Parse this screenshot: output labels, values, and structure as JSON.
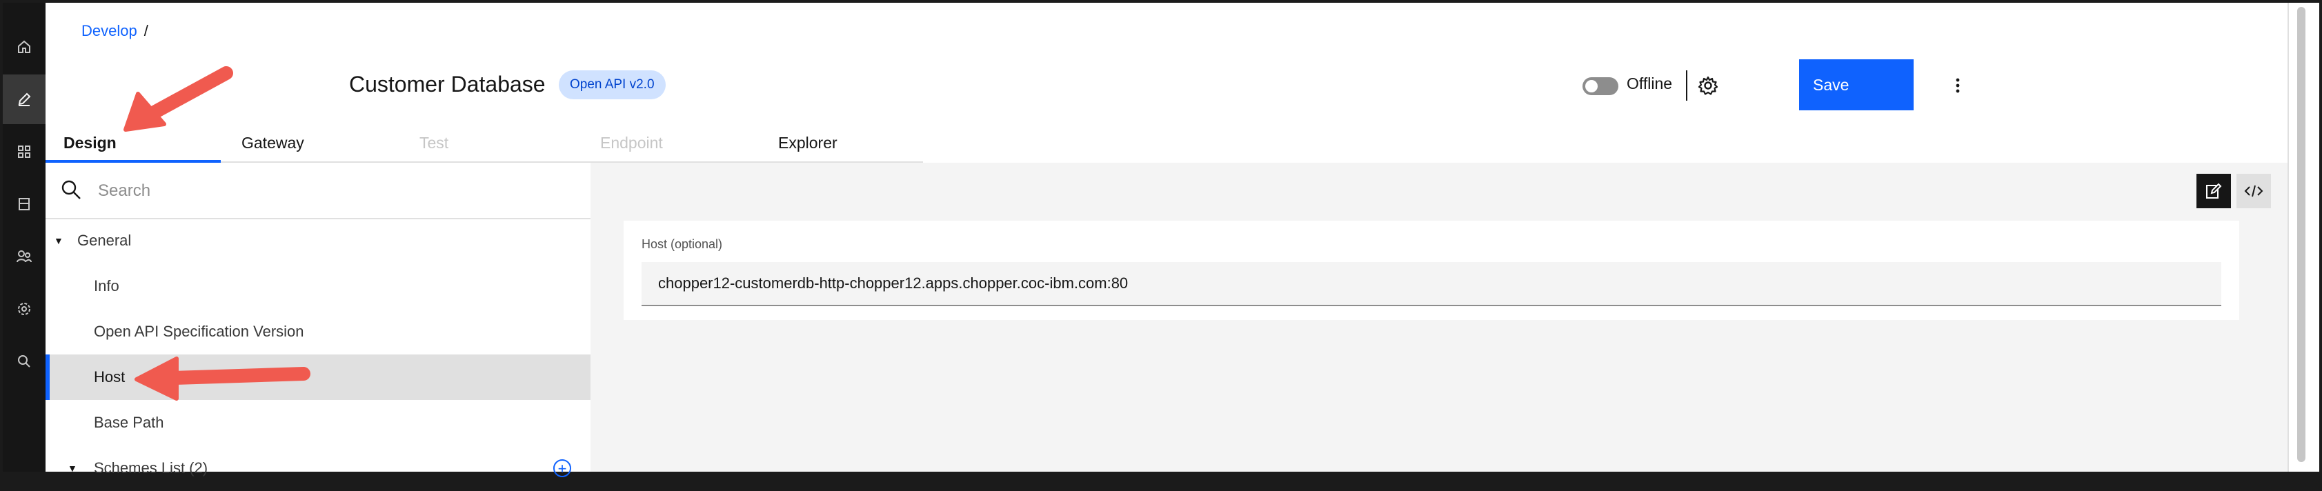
{
  "breadcrumb": {
    "root": "Develop",
    "separator": "/"
  },
  "header": {
    "title": "Customer Database",
    "badge": "Open API v2.0",
    "status_label": "Offline",
    "save_label": "Save"
  },
  "rail": {
    "icons": [
      "home-icon",
      "edit-icon",
      "apps-icon",
      "catalog-icon",
      "users-icon",
      "settings-icon",
      "search-icon"
    ],
    "active_index": 1
  },
  "tabs": [
    {
      "label": "Design",
      "state": "active"
    },
    {
      "label": "Gateway",
      "state": "normal"
    },
    {
      "label": "Test",
      "state": "disabled"
    },
    {
      "label": "Endpoint",
      "state": "disabled"
    },
    {
      "label": "Explorer",
      "state": "normal"
    }
  ],
  "sidebar": {
    "search_placeholder": "Search",
    "section": "General",
    "items": [
      "Info",
      "Open API Specification Version",
      "Host",
      "Base Path"
    ],
    "selected": "Host",
    "schemes_label": "Schemes List (2)"
  },
  "host_form": {
    "label": "Host (optional)",
    "value": "chopper12-customerdb-http-chopper12.apps.chopper.coc-ibm.com:80"
  },
  "colors": {
    "accent": "#0f62fe",
    "annotation_arrow": "#f05a4f",
    "rail_bg": "#161616",
    "badge_bg": "#d0e2ff"
  }
}
